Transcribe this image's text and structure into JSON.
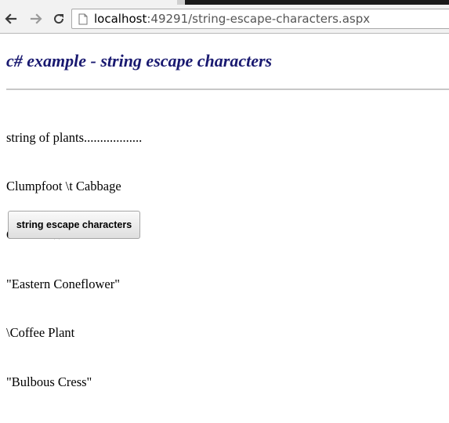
{
  "browser": {
    "url_host": "localhost",
    "url_path": ":49291/string-escape-characters.aspx",
    "icons": {
      "back": "back-arrow-icon",
      "forward": "forward-arrow-icon",
      "reload": "reload-icon",
      "page": "page-icon"
    }
  },
  "page": {
    "heading": "c# example - string escape characters",
    "heading_color": "#191970",
    "output_lines": [
      "string of plants..................",
      "Clumpfoot \\t Cabbage",
      "Colic \\n Weed",
      "\"Eastern Coneflower\"",
      "\\Coffee Plant",
      "\"Bulbous Cress\""
    ],
    "button_label": "string escape characters"
  }
}
